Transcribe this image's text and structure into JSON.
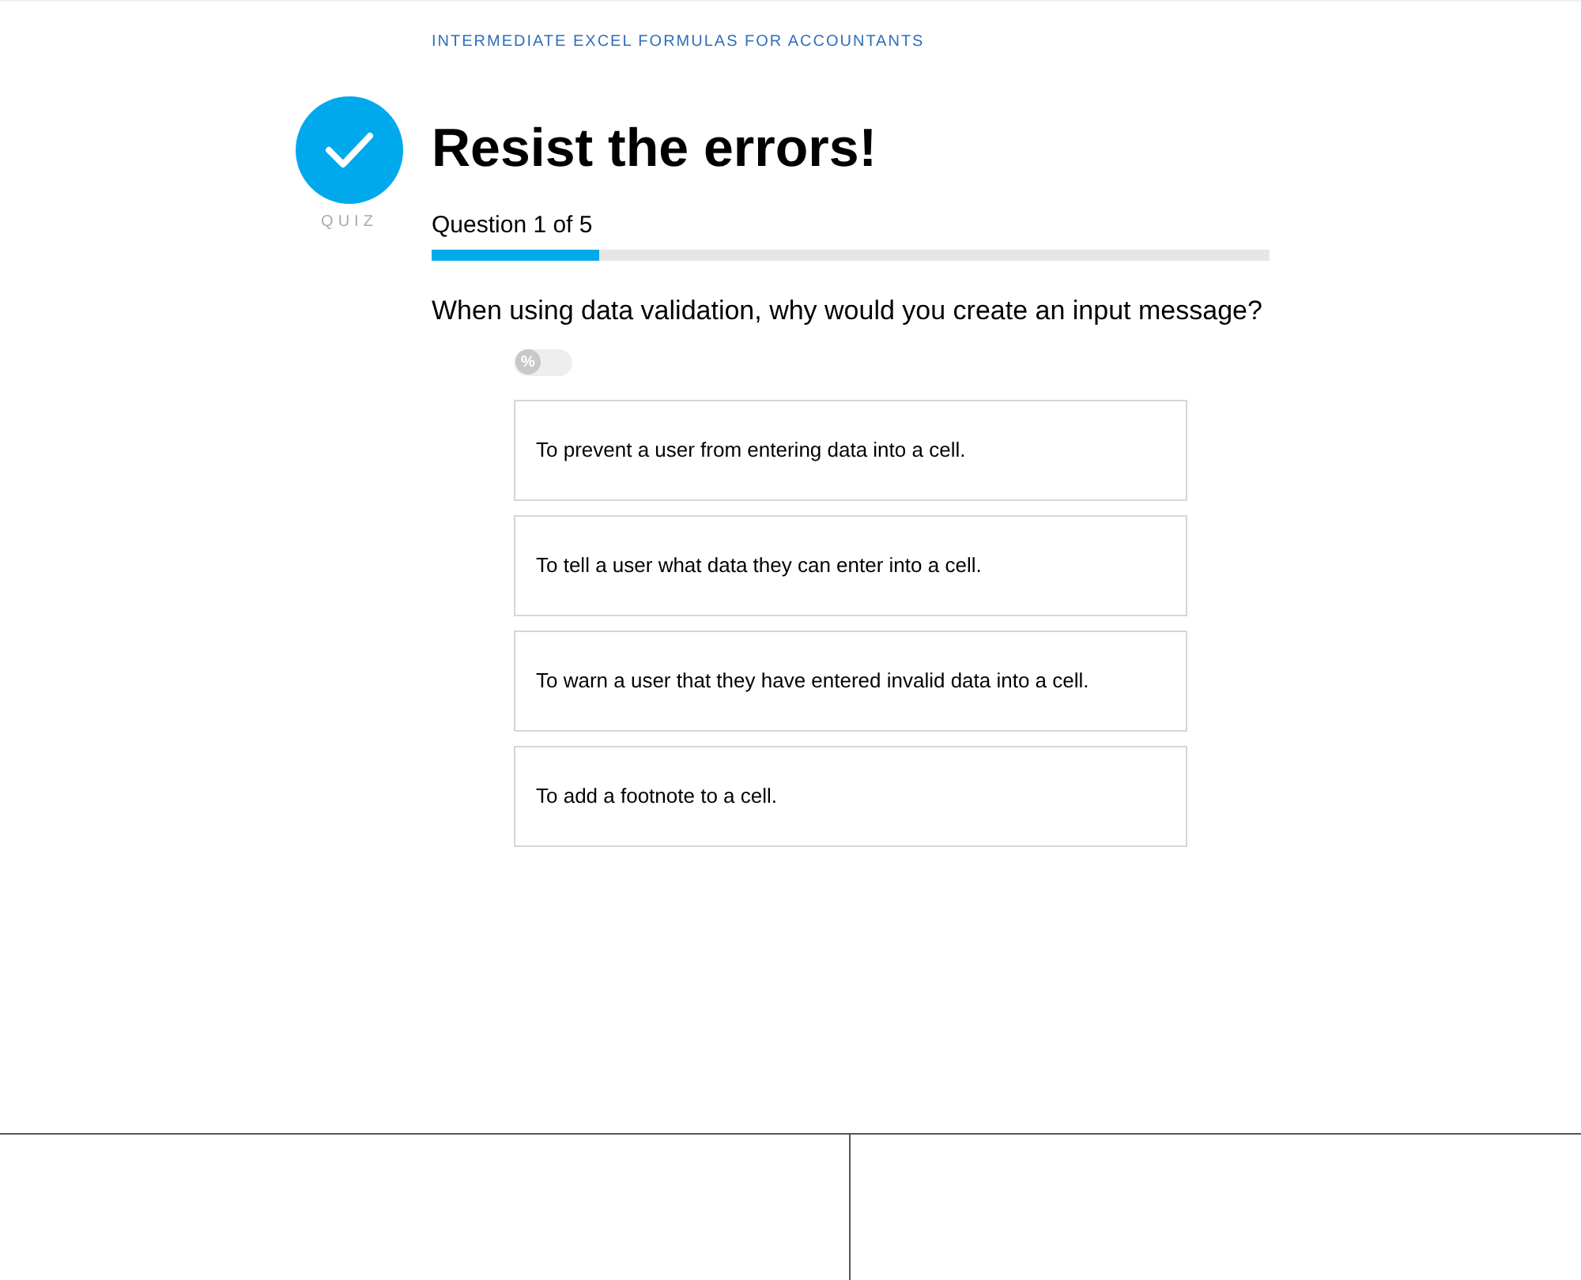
{
  "course": "INTERMEDIATE EXCEL FORMULAS FOR ACCOUNTANTS",
  "badge": {
    "label": "QUIZ"
  },
  "title": "Resist the errors!",
  "progress": {
    "label": "Question 1 of 5",
    "level": 0.2
  },
  "question": "When using data validation, why would you create an input message?",
  "percent_toggle": {
    "symbol": "%",
    "on": false
  },
  "answers": [
    {
      "text": "To prevent a user from entering data into a cell.",
      "selected": false
    },
    {
      "text": "To tell a user what data they can enter into a cell.",
      "selected": false
    },
    {
      "text": "To warn a user that they have entered invalid data into a cell.",
      "selected": false
    },
    {
      "text": "To add a footnote to a cell.",
      "selected": false
    }
  ]
}
